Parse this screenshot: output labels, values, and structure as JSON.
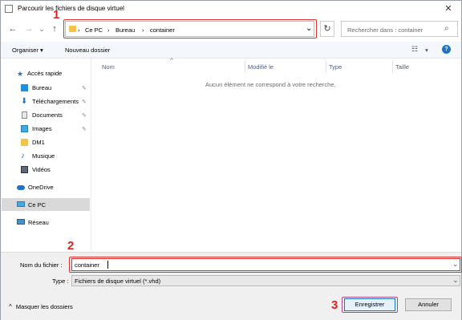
{
  "window": {
    "title": "Parcourir les fichiers de disque virtuel",
    "close_glyph": "✕"
  },
  "nav": {
    "back": "←",
    "forward": "→",
    "recent": "⌄",
    "up": "↑"
  },
  "address": {
    "sep": "›",
    "crumbs": [
      "Ce PC",
      "Bureau",
      "container"
    ],
    "dropdown": "⌄"
  },
  "refresh_glyph": "↻",
  "search": {
    "placeholder": "Rechercher dans : container",
    "icon_glyph": "⌕"
  },
  "toolbar": {
    "organize": "Organiser",
    "organize_arrow": "▾",
    "new_folder": "Nouveau dossier",
    "view_glyph": "☷",
    "view_arrow": "▾",
    "help": "?"
  },
  "sidebar": {
    "items": [
      {
        "label": "Accès rapide",
        "icon": "star-icon"
      },
      {
        "label": "Bureau",
        "icon": "desktop-icon"
      },
      {
        "label": "Téléchargements",
        "icon": "download-icon"
      },
      {
        "label": "Documents",
        "icon": "documents-icon"
      },
      {
        "label": "Images",
        "icon": "images-icon"
      },
      {
        "label": "DM1",
        "icon": "folder-icon"
      },
      {
        "label": "Musique",
        "icon": "music-icon"
      },
      {
        "label": "Vidéos",
        "icon": "videos-icon"
      },
      {
        "label": "OneDrive",
        "icon": "cloud-icon"
      },
      {
        "label": "Ce PC",
        "icon": "pc-icon"
      },
      {
        "label": "Réseau",
        "icon": "network-icon"
      }
    ],
    "pin_glyph": "✎"
  },
  "columns": [
    "Nom",
    "Modifié le",
    "Type",
    "Taille"
  ],
  "sort_glyph": "^",
  "empty_message": "Aucun élément ne correspond à votre recherche.",
  "form": {
    "filename_label": "Nom du fichier :",
    "filename_value": "container",
    "type_label": "Type :",
    "type_value": "Fichiers de disque virtuel (*.vhd)",
    "dropdown_glyph": "⌄"
  },
  "footer": {
    "hide_folders": "Masquer les dossiers",
    "hide_arrow": "^",
    "save": "Enregistrer",
    "cancel": "Annuler"
  },
  "annotations": [
    "1",
    "2",
    "3"
  ],
  "colors": {
    "highlight": "#e03030",
    "accent": "#1e73c8",
    "selection": "#d9d9d9"
  }
}
